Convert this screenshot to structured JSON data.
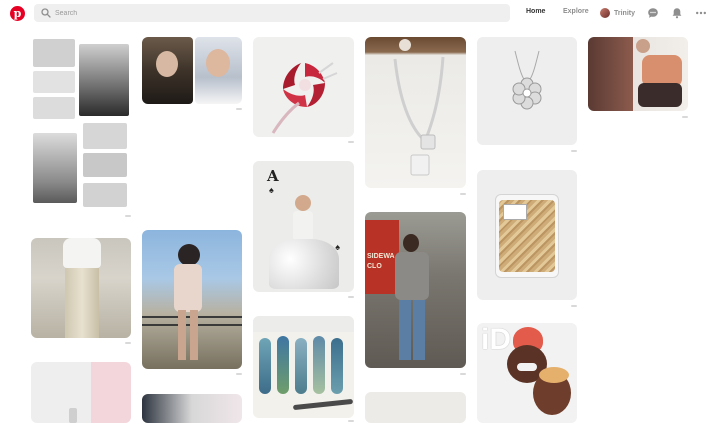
{
  "app": {
    "logo_letter": "p",
    "brand_color": "#e60023"
  },
  "header": {
    "search_placeholder": "Search",
    "nav_home": "Home",
    "nav_explore": "Explore",
    "username": "Trinity",
    "icons": [
      "pinterest-logo-icon",
      "search-icon",
      "message-icon",
      "bell-icon",
      "more-icon"
    ]
  },
  "pins": {
    "p8_card_letter": "A",
    "p11_sign_text": "SIDEWA CLO",
    "p15_overlay_text": "iD"
  }
}
